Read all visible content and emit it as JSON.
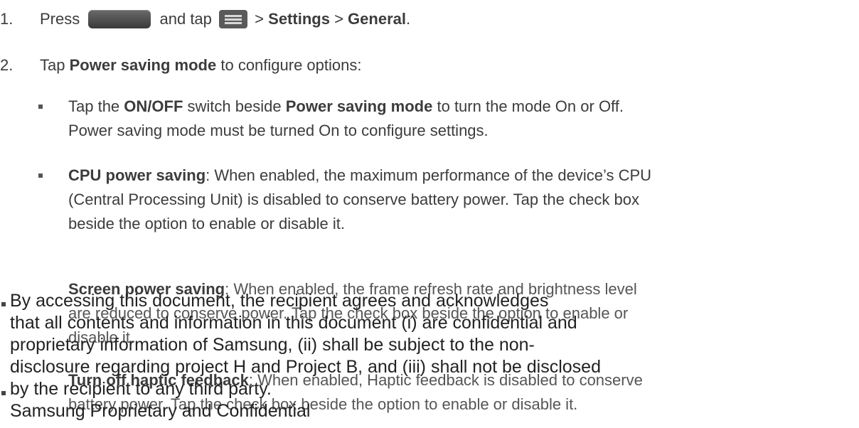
{
  "steps": [
    {
      "number": "1.",
      "pre": "Press",
      "mid": "and tap",
      "sep1": ">",
      "settings": "Settings",
      "sep2": ">",
      "general": "General",
      "end": "."
    },
    {
      "number": "2.",
      "pre": "Tap",
      "bold": "Power saving mode",
      "post": "to configure options:"
    }
  ],
  "icons": {
    "home_button": "home-key-icon",
    "menu_button": "menu-key-icon"
  },
  "bullets": [
    {
      "pre": "Tap the",
      "bold1": "ON/OFF",
      "mid": "switch beside",
      "bold2": "Power saving mode",
      "post": "to turn the mode On or Off.",
      "line2": "Power saving mode must be turned On to configure settings."
    },
    {
      "bold": "CPU power saving",
      "line1": ": When enabled, the maximum performance of the device’s CPU",
      "line2": "(Central Processing Unit) is disabled to conserve battery power. Tap the check box",
      "line3": "beside the option to enable or disable it."
    },
    {
      "bold": "Screen power saving",
      "line1": ": When enabled, the frame refresh rate and brightness level",
      "line2": "are reduced to conserve power. Tap the check box beside the option to enable or",
      "line3": "disable it."
    },
    {
      "bold": "Turn off haptic feedback",
      "line1": ": When enabled, Haptic feedback is disabled to conserve",
      "line2": "battery power. Tap the check box beside the option to enable or disable it."
    }
  ],
  "watermark": {
    "line1": "By accessing this document, the recipient agrees and acknowledges",
    "line2": "that all contents and information in this document (i) are confidential and",
    "line3": "proprietary information of Samsung, (ii) shall be subject to the non-",
    "line4": "disclosure regarding project H and Project B, and (iii) shall not be disclosed",
    "line5": "by the recipient to any third party.",
    "line6": "Samsung Proprietary and Confidential"
  }
}
